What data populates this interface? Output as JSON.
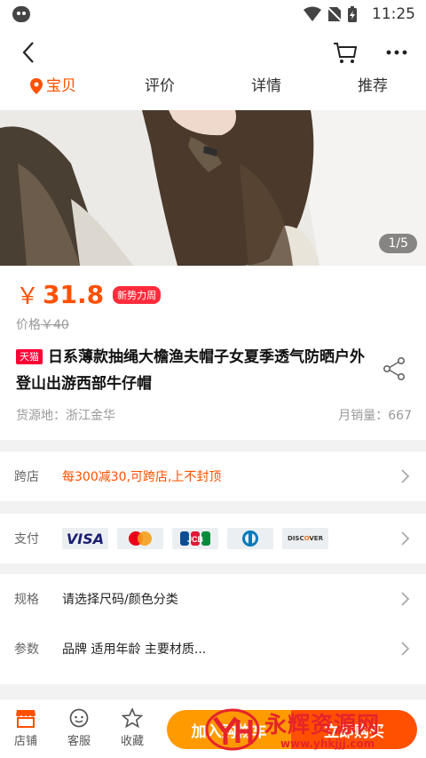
{
  "status_bar": {
    "time": "11:25"
  },
  "tabs": [
    {
      "label": "宝贝",
      "active": true
    },
    {
      "label": "评价",
      "active": false
    },
    {
      "label": "详情",
      "active": false
    },
    {
      "label": "推荐",
      "active": false
    }
  ],
  "gallery": {
    "counter": "1/5"
  },
  "product": {
    "currency": "￥",
    "price": "31.8",
    "price_tag": "新势力周",
    "old_price_label": "价格",
    "old_price": "￥40",
    "store_badge": "天猫",
    "title": "日系薄款抽绳大檐渔夫帽子女夏季透气防晒户外登山出游西部牛仔帽",
    "origin": "货源地：浙江金华",
    "monthly_sales": "月销量：667"
  },
  "promo_row": {
    "label": "跨店",
    "value": "每300减30,可跨店,上不封顶"
  },
  "payment_row": {
    "label": "支付",
    "methods": [
      {
        "name": "VISA",
        "color": "#1a1f71"
      },
      {
        "name": "mastercard",
        "color": "#eb001b"
      },
      {
        "name": "JCB",
        "color": "#0b8a3e"
      },
      {
        "name": "Diners Club",
        "color": "#0079be"
      },
      {
        "name": "DISCOVER",
        "color": "#f47216"
      }
    ]
  },
  "spec_row": {
    "label": "规格",
    "value": "请选择尺码/颜色分类"
  },
  "param_row": {
    "label": "参数",
    "value": "品牌 适用年龄 主要材质..."
  },
  "bottom_bar": {
    "shop_label": "店铺",
    "service_label": "客服",
    "favorite_label": "收藏",
    "add_cart_label": "加入购物车",
    "buy_label": "立即购买"
  },
  "watermark": {
    "text": "永辉资源网",
    "url": "www.yhkjjj.com"
  },
  "colors": {
    "accent": "#ff5000",
    "tmall": "#ff0036"
  }
}
